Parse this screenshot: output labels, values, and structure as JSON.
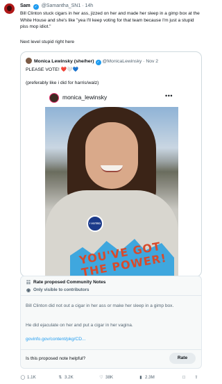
{
  "tweet": {
    "author_name": "Sam",
    "author_handle": "@Samantha_SN1",
    "time": "14h",
    "text": "Bill Clinton stuck cigars in her ass, jizzed on her and made her sleep in a gimp box at the White House and she's like \"yea I'll keep voting for that team because I'm just a stupid piss mop idiot.\"",
    "text2": "Next level stupid right here"
  },
  "quote": {
    "author_name": "Monica Lewinsky (she/her)",
    "author_handle": "@MonicaLewinsky",
    "date": "Nov 2",
    "line1": "PLEASE VOTE! ❤️🤍💙",
    "line2": "(preferably like i did for harris/walz)",
    "embed": {
      "username": "monica_lewinsky",
      "sticker": "I VOTED",
      "shirt_text": "YOU'VE GOT THE POWER!"
    }
  },
  "community_notes": {
    "title": "Rate proposed Community Notes",
    "visibility": "Only visible to contributors",
    "body1": "Bill Clinton did not out a cigar in her ass or make her sleep in a gimp box.",
    "body2": "He did ejaculate on her and put a cigar in her vagina.",
    "link": "govinfo.gov/content/pkg/CD...",
    "question": "Is this proposed note helpful?",
    "rate_label": "Rate"
  },
  "actions": {
    "replies": "1.1K",
    "reposts": "3.2K",
    "likes": "38K",
    "views": "2.3M"
  }
}
